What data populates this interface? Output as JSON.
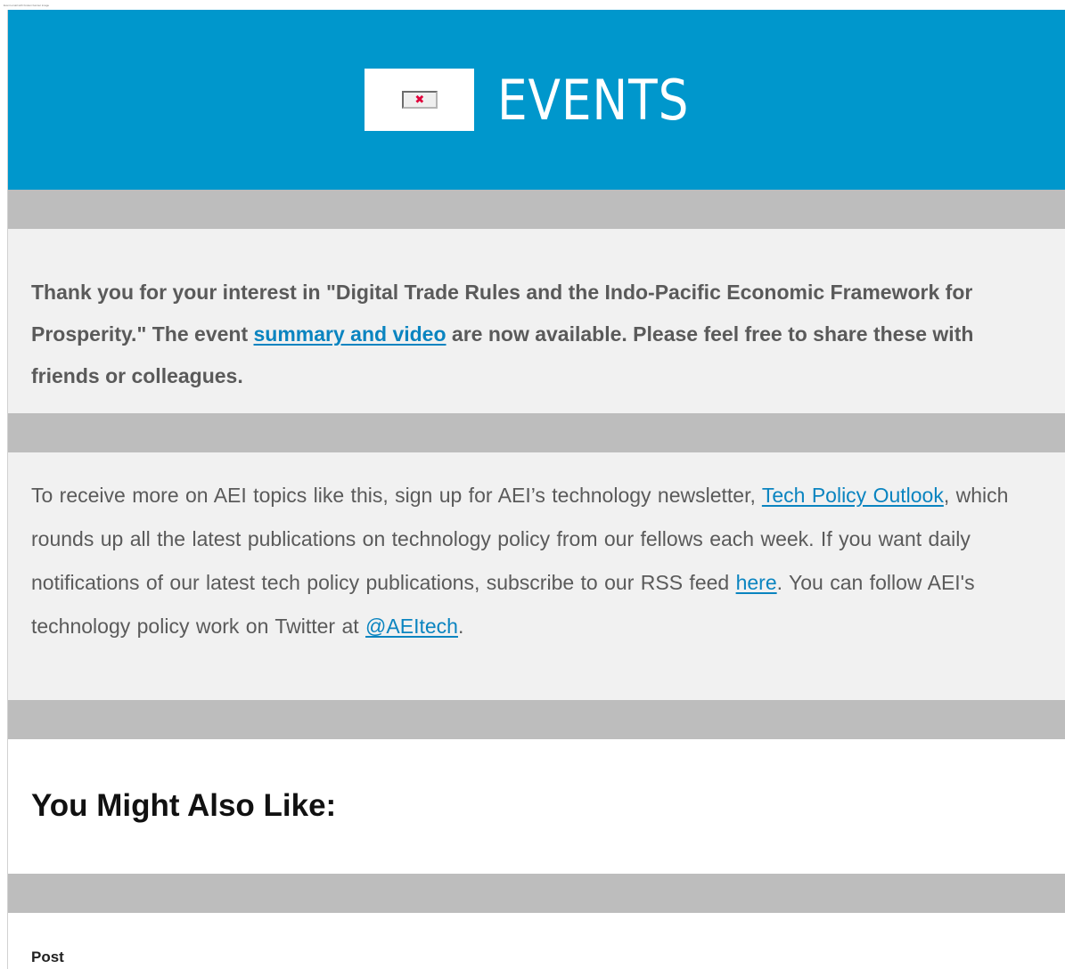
{
  "caption": "Event email with broken banner image",
  "banner": {
    "title": "EVENTS",
    "logo_icon": "broken-image-icon",
    "background_color": "#0097cc"
  },
  "intro": {
    "text_1": "Thank you for your interest in \"Digital Trade Rules and the Indo-Pacific Economic Framework for Prosperity.\" The event ",
    "link_summary": "summary and video",
    "text_2": " are now available. Please feel free to share these with friends or colleagues."
  },
  "newsletter": {
    "text_1": "To receive more on AEI topics like this, sign up for AEI’s technology newsletter, ",
    "link_newsletter": "Tech Policy Outlook",
    "text_2": ", which rounds up all the latest publications on technology policy from our fellows each week. If you want daily notifications of our latest tech policy publications, subscribe to our RSS feed ",
    "link_rss": "here",
    "text_3": ". You can follow AEI's technology policy work on Twitter at ",
    "link_twitter": "@AEItech",
    "text_4": "."
  },
  "recommendations": {
    "heading": "You Might Also Like:",
    "first_item_type": "Post"
  },
  "colors": {
    "link": "#0a84c0",
    "divider": "#bdbdbd",
    "panel": "#f1f1f1"
  }
}
